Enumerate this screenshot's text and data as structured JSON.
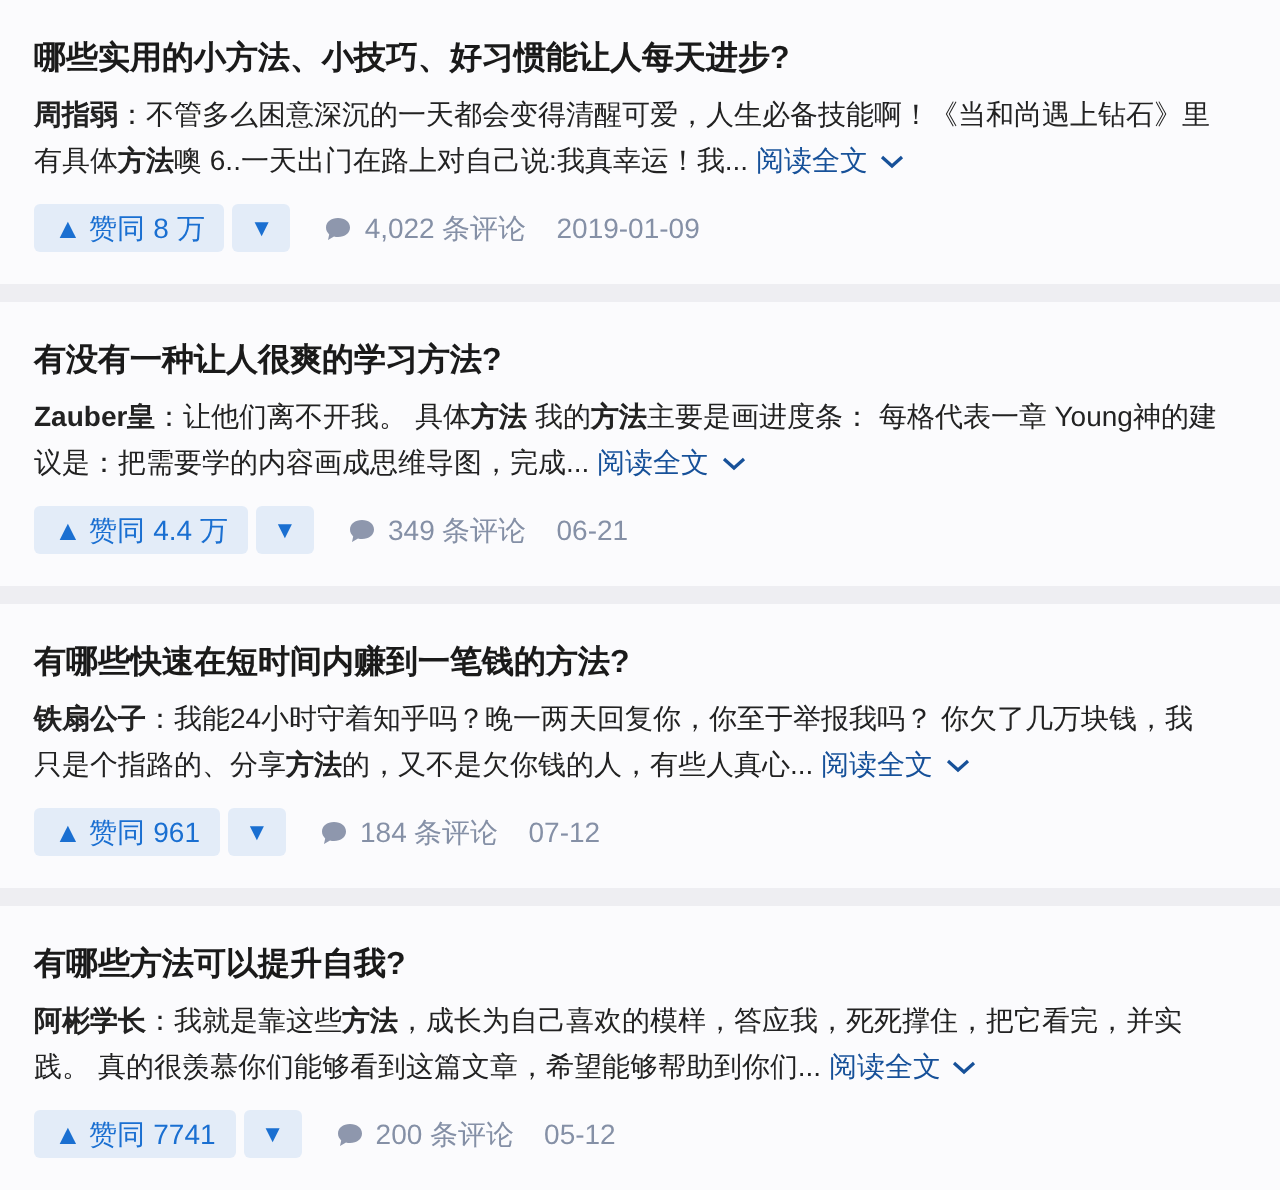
{
  "answers": [
    {
      "title": "哪些实用的小**方法**、小技巧、好习惯能让人每天进步?",
      "author": "周指弱",
      "excerpt": "：不管多么困意深沉的一天都会变得清醒可爱，人生必备技能啊！《当和尚遇上钻石》里有具体**方法**噢 6..一天出门在路上对自己说:我真幸运！我...",
      "read_more": "阅读全文",
      "upvote": "▲ 赞同 8 万",
      "downvote": "▼",
      "comments": "4,022 条评论",
      "date": "2019-01-09"
    },
    {
      "title": "有没有一种让人很爽的学习**方法**?",
      "author": "Zauber皇",
      "excerpt": "：让他们离不开我。 具体**方法** 我的**方法**主要是画进度条： 每格代表一章 Young神的建议是：把需要学的内容画成思维导图，完成...",
      "read_more": "阅读全文",
      "upvote": "▲ 赞同 4.4 万",
      "downvote": "▼",
      "comments": "349 条评论",
      "date": "06-21"
    },
    {
      "title": "有哪些快速在短时间内赚到一笔钱的**方法**?",
      "author": "铁扇公子",
      "excerpt": "：我能24小时守着知乎吗？晚一两天回复你，你至于举报我吗？ 你欠了几万块钱，我只是个指路的、分享**方法**的，又不是欠你钱的人，有些人真心...",
      "read_more": "阅读全文",
      "upvote": "▲ 赞同 961",
      "downvote": "▼",
      "comments": "184 条评论",
      "date": "07-12"
    },
    {
      "title": "有哪些**方法**可以提升自我?",
      "author": "阿彬学长",
      "excerpt": "：我就是靠这些**方法**，成长为自己喜欢的模样，答应我，死死撑住，把它看完，并实践。 真的很羡慕你们能够看到这篇文章，希望能够帮助到你们...",
      "read_more": "阅读全文",
      "upvote": "▲ 赞同 7741",
      "downvote": "▼",
      "comments": "200 条评论",
      "date": "05-12"
    }
  ]
}
